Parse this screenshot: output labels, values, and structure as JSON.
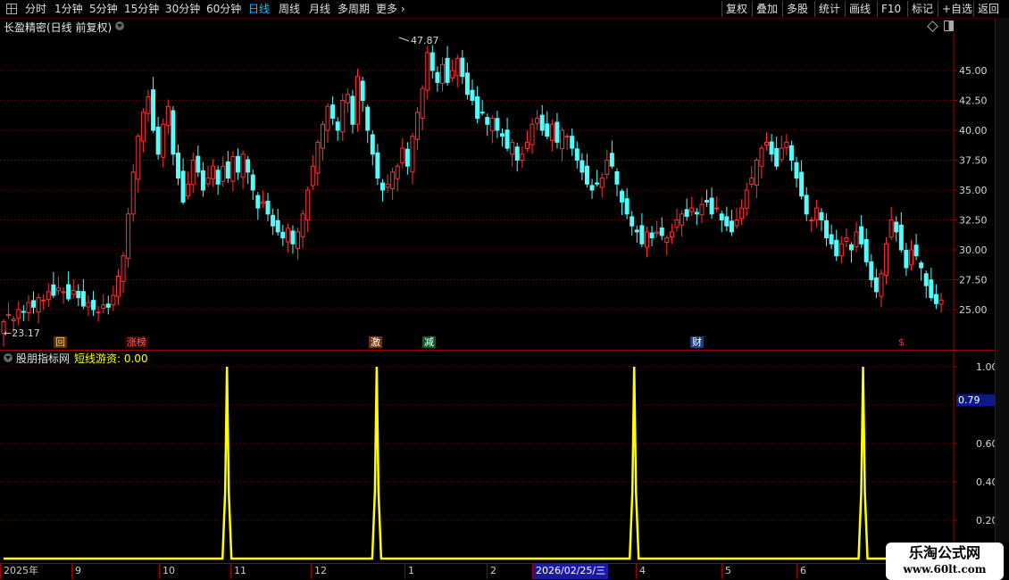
{
  "toolbar": {
    "periods": [
      "分时",
      "1分钟",
      "5分钟",
      "15分钟",
      "30分钟",
      "60分钟",
      "日线",
      "周线",
      "月线",
      "多周期",
      "更多 ›"
    ],
    "active_period": "日线",
    "right_buttons": [
      "复权",
      "叠加",
      "多股",
      "统计",
      "画线",
      "F10",
      "标记",
      "+自选",
      "返回"
    ]
  },
  "main_chart": {
    "title": "长盈精密(日线 前复权)",
    "high_label": "47.87",
    "low_label": "←23.17",
    "y_ticks": [
      "45.00",
      "42.50",
      "40.00",
      "37.50",
      "35.00",
      "32.50",
      "30.00",
      "27.50",
      "25.00"
    ],
    "events": [
      {
        "text": "回",
        "color": "#ffcc66",
        "bg": "#5a3000"
      },
      {
        "text": "涨榜",
        "color": "#ff6060",
        "bg": "#3a0000"
      },
      {
        "text": "激",
        "color": "#ffffff",
        "bg": "#7a3000"
      },
      {
        "text": "减",
        "color": "#ffffff",
        "bg": "#00602a"
      },
      {
        "text": "财",
        "color": "#ffffff",
        "bg": "#1a3a8a"
      },
      {
        "text": "$",
        "color": "#ff3030",
        "bg": "#000000"
      }
    ]
  },
  "indicator_panel": {
    "title": "股朋指标网",
    "series_label": "短线游资: 0.00",
    "y_ticks": [
      "1.00",
      "0.60",
      "0.40",
      "0.20"
    ],
    "cursor_value": "0.79"
  },
  "date_axis": {
    "labels": [
      "2025年",
      "9",
      "10",
      "11",
      "12",
      "1",
      "2",
      "2026/02/25/三",
      "4",
      "5",
      "6"
    ]
  },
  "watermark": {
    "line1": "乐淘公式网",
    "line2": "www.60lt.com"
  },
  "chart_data": [
    {
      "type": "candlestick",
      "title": "长盈精密(日线 前复权)",
      "ylim": [
        22.5,
        48.5
      ],
      "y_ticks": [
        25.0,
        27.5,
        30.0,
        32.5,
        35.0,
        37.5,
        40.0,
        42.5,
        45.0
      ],
      "annotations": {
        "max": 47.87,
        "min": 23.17
      },
      "up_color": "#ff3232",
      "down_color": "#54fcfc",
      "closes": [
        24.0,
        24.6,
        24.2,
        25.0,
        24.8,
        25.6,
        25.2,
        26.0,
        25.8,
        26.5,
        26.2,
        26.8,
        26.5,
        25.9,
        26.6,
        26.0,
        25.3,
        25.6,
        25.0,
        24.8,
        25.4,
        25.2,
        26.2,
        27.8,
        29.5,
        33.0,
        36.5,
        39.5,
        41.5,
        42.8,
        40.0,
        38.0,
        40.5,
        42.0,
        38.0,
        36.0,
        34.0,
        35.5,
        37.5,
        36.5,
        35.0,
        36.0,
        37.0,
        35.5,
        37.0,
        36.0,
        37.8,
        36.5,
        38.0,
        36.5,
        35.0,
        33.5,
        34.0,
        33.0,
        32.0,
        31.5,
        31.0,
        31.8,
        30.5,
        31.5,
        33.0,
        35.0,
        37.0,
        39.0,
        40.5,
        42.0,
        41.0,
        40.0,
        42.5,
        43.0,
        40.5,
        44.5,
        42.5,
        40.0,
        38.0,
        36.0,
        35.0,
        35.5,
        36.5,
        37.0,
        38.5,
        37.0,
        39.5,
        41.5,
        43.5,
        46.5,
        45.0,
        44.0,
        45.5,
        44.0,
        45.0,
        46.0,
        44.5,
        43.0,
        42.5,
        41.0,
        41.5,
        40.5,
        41.0,
        40.0,
        39.5,
        38.5,
        39.0,
        37.5,
        38.0,
        39.0,
        40.5,
        41.0,
        40.0,
        39.5,
        40.5,
        39.0,
        40.0,
        39.5,
        38.5,
        37.5,
        36.5,
        35.5,
        35.0,
        35.5,
        36.0,
        37.5,
        37.0,
        35.5,
        34.0,
        33.0,
        32.0,
        31.5,
        30.5,
        31.5,
        31.0,
        31.5,
        31.2,
        31.0,
        31.5,
        32.5,
        33.0,
        32.8,
        33.5,
        33.0,
        33.8,
        34.0,
        33.0,
        33.5,
        32.5,
        32.0,
        31.5,
        32.5,
        33.5,
        35.0,
        36.0,
        37.5,
        38.5,
        39.0,
        38.0,
        37.0,
        38.5,
        39.0,
        37.5,
        36.0,
        34.5,
        33.0,
        32.5,
        33.5,
        32.5,
        31.0,
        30.5,
        29.5,
        30.5,
        31.0,
        30.0,
        31.5,
        30.5,
        29.0,
        27.5,
        26.5,
        28.0,
        30.5,
        32.5,
        31.5,
        30.0,
        28.5,
        30.0,
        29.5,
        28.5,
        27.0,
        26.0,
        25.5,
        25.8
      ]
    },
    {
      "type": "line",
      "title": "股朋指标网",
      "series": [
        {
          "name": "短线游资",
          "color": "#ffff00"
        }
      ],
      "ylim": [
        0.0,
        1.05
      ],
      "y_ticks": [
        0.2,
        0.4,
        0.6,
        0.79,
        1.0
      ],
      "spike_positions": [
        0.238,
        0.395,
        0.665,
        0.905
      ],
      "spike_value": 1.0,
      "baseline": 0.0
    }
  ]
}
